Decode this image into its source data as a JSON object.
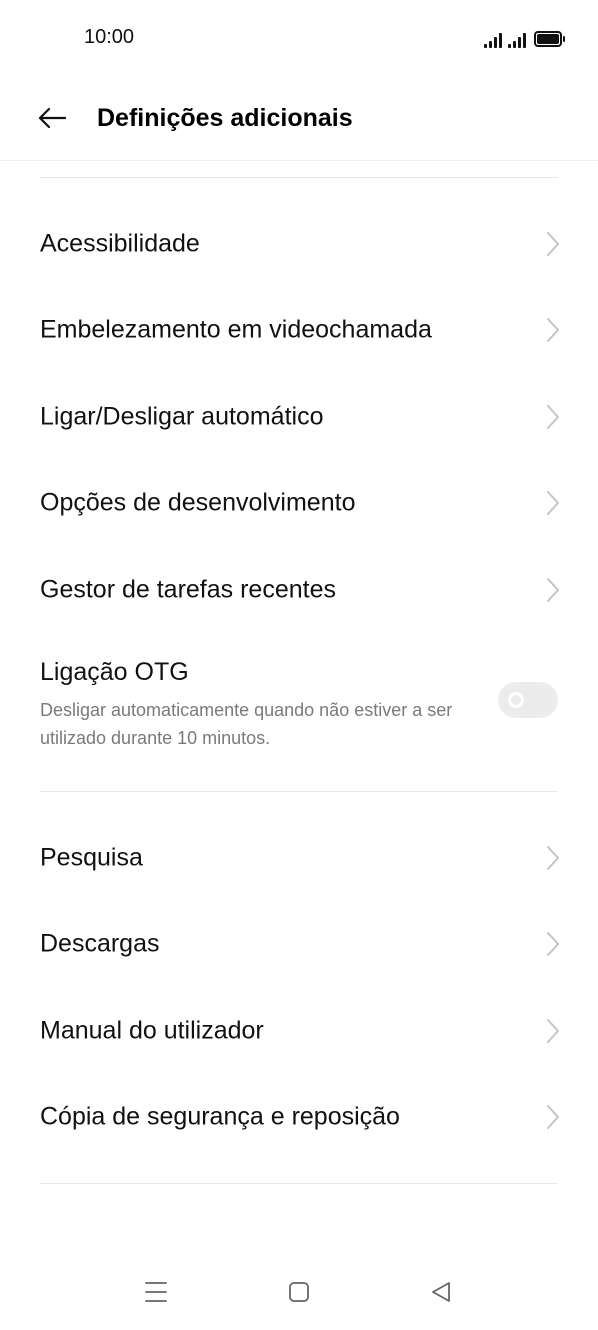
{
  "status_bar": {
    "time": "10:00"
  },
  "header": {
    "title": "Definições adicionais"
  },
  "group1": [
    {
      "label": "Acessibilidade"
    },
    {
      "label": "Embelezamento em videochamada"
    },
    {
      "label": "Ligar/Desligar automático"
    },
    {
      "label": "Opções de desenvolvimento"
    },
    {
      "label": "Gestor de tarefas recentes"
    }
  ],
  "otg": {
    "title": "Ligação OTG",
    "description": "Desligar automaticamente quando não estiver a ser utilizado durante 10 minutos.",
    "enabled": false
  },
  "group2": [
    {
      "label": "Pesquisa"
    },
    {
      "label": "Descargas"
    },
    {
      "label": "Manual do utilizador"
    },
    {
      "label": "Cópia de segurança e reposição"
    }
  ],
  "icons": {
    "back": "arrow-left-icon",
    "chevron": "chevron-right-icon",
    "nav_menu": "menu-icon",
    "nav_home": "square-icon",
    "nav_back": "triangle-back-icon"
  },
  "colors": {
    "text_primary": "#111111",
    "text_secondary": "#7a7a7a",
    "divider": "#e8e8e8",
    "toggle_off": "#ececec"
  }
}
